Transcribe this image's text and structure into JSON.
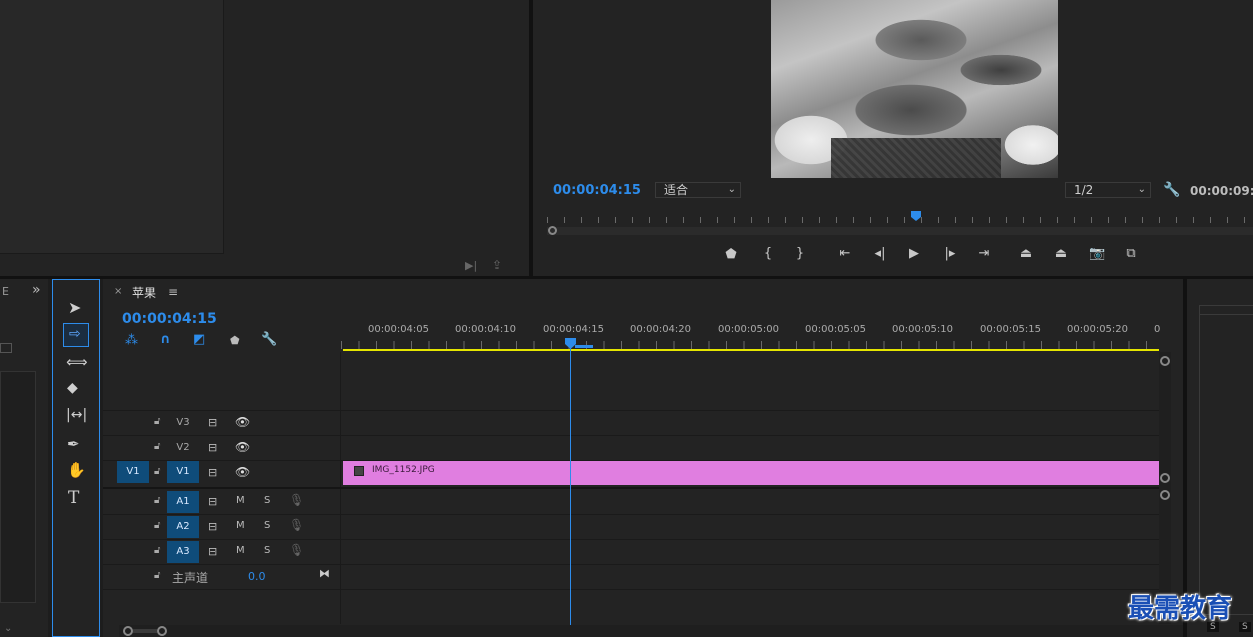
{
  "colors": {
    "accent": "#2d8ceb",
    "clip": "#e07ee0",
    "work_area": "#e5e500",
    "playhead": "#2d8ceb"
  },
  "program": {
    "timecode": "00:00:04:15",
    "fit_value": "适合",
    "resolution": "1/2",
    "duration": "00:00:09:"
  },
  "sequence": {
    "tab_name": "苹果",
    "timecode": "00:00:04:15",
    "ruler_labels": [
      "00:00:04:05",
      "00:00:04:10",
      "00:00:04:15",
      "00:00:04:20",
      "00:00:05:00",
      "00:00:05:05",
      "00:00:05:10",
      "00:00:05:15",
      "00:00:05:20",
      "0"
    ],
    "video_tracks": [
      {
        "name": "V3",
        "source": ""
      },
      {
        "name": "V2",
        "source": ""
      },
      {
        "name": "V1",
        "source": "V1"
      }
    ],
    "audio_tracks": [
      {
        "name": "A1",
        "m": "M",
        "s": "S"
      },
      {
        "name": "A2",
        "m": "M",
        "s": "S"
      },
      {
        "name": "A3",
        "m": "M",
        "s": "S"
      }
    ],
    "master_label": "主声道",
    "master_value": "0.0",
    "clip_name": "IMG_1152.JPG"
  },
  "left_panel": {
    "chars": [
      "E",
      "»"
    ]
  },
  "watermark": "最需教育",
  "right_panel": {
    "s_labels": [
      "S",
      "S"
    ]
  }
}
